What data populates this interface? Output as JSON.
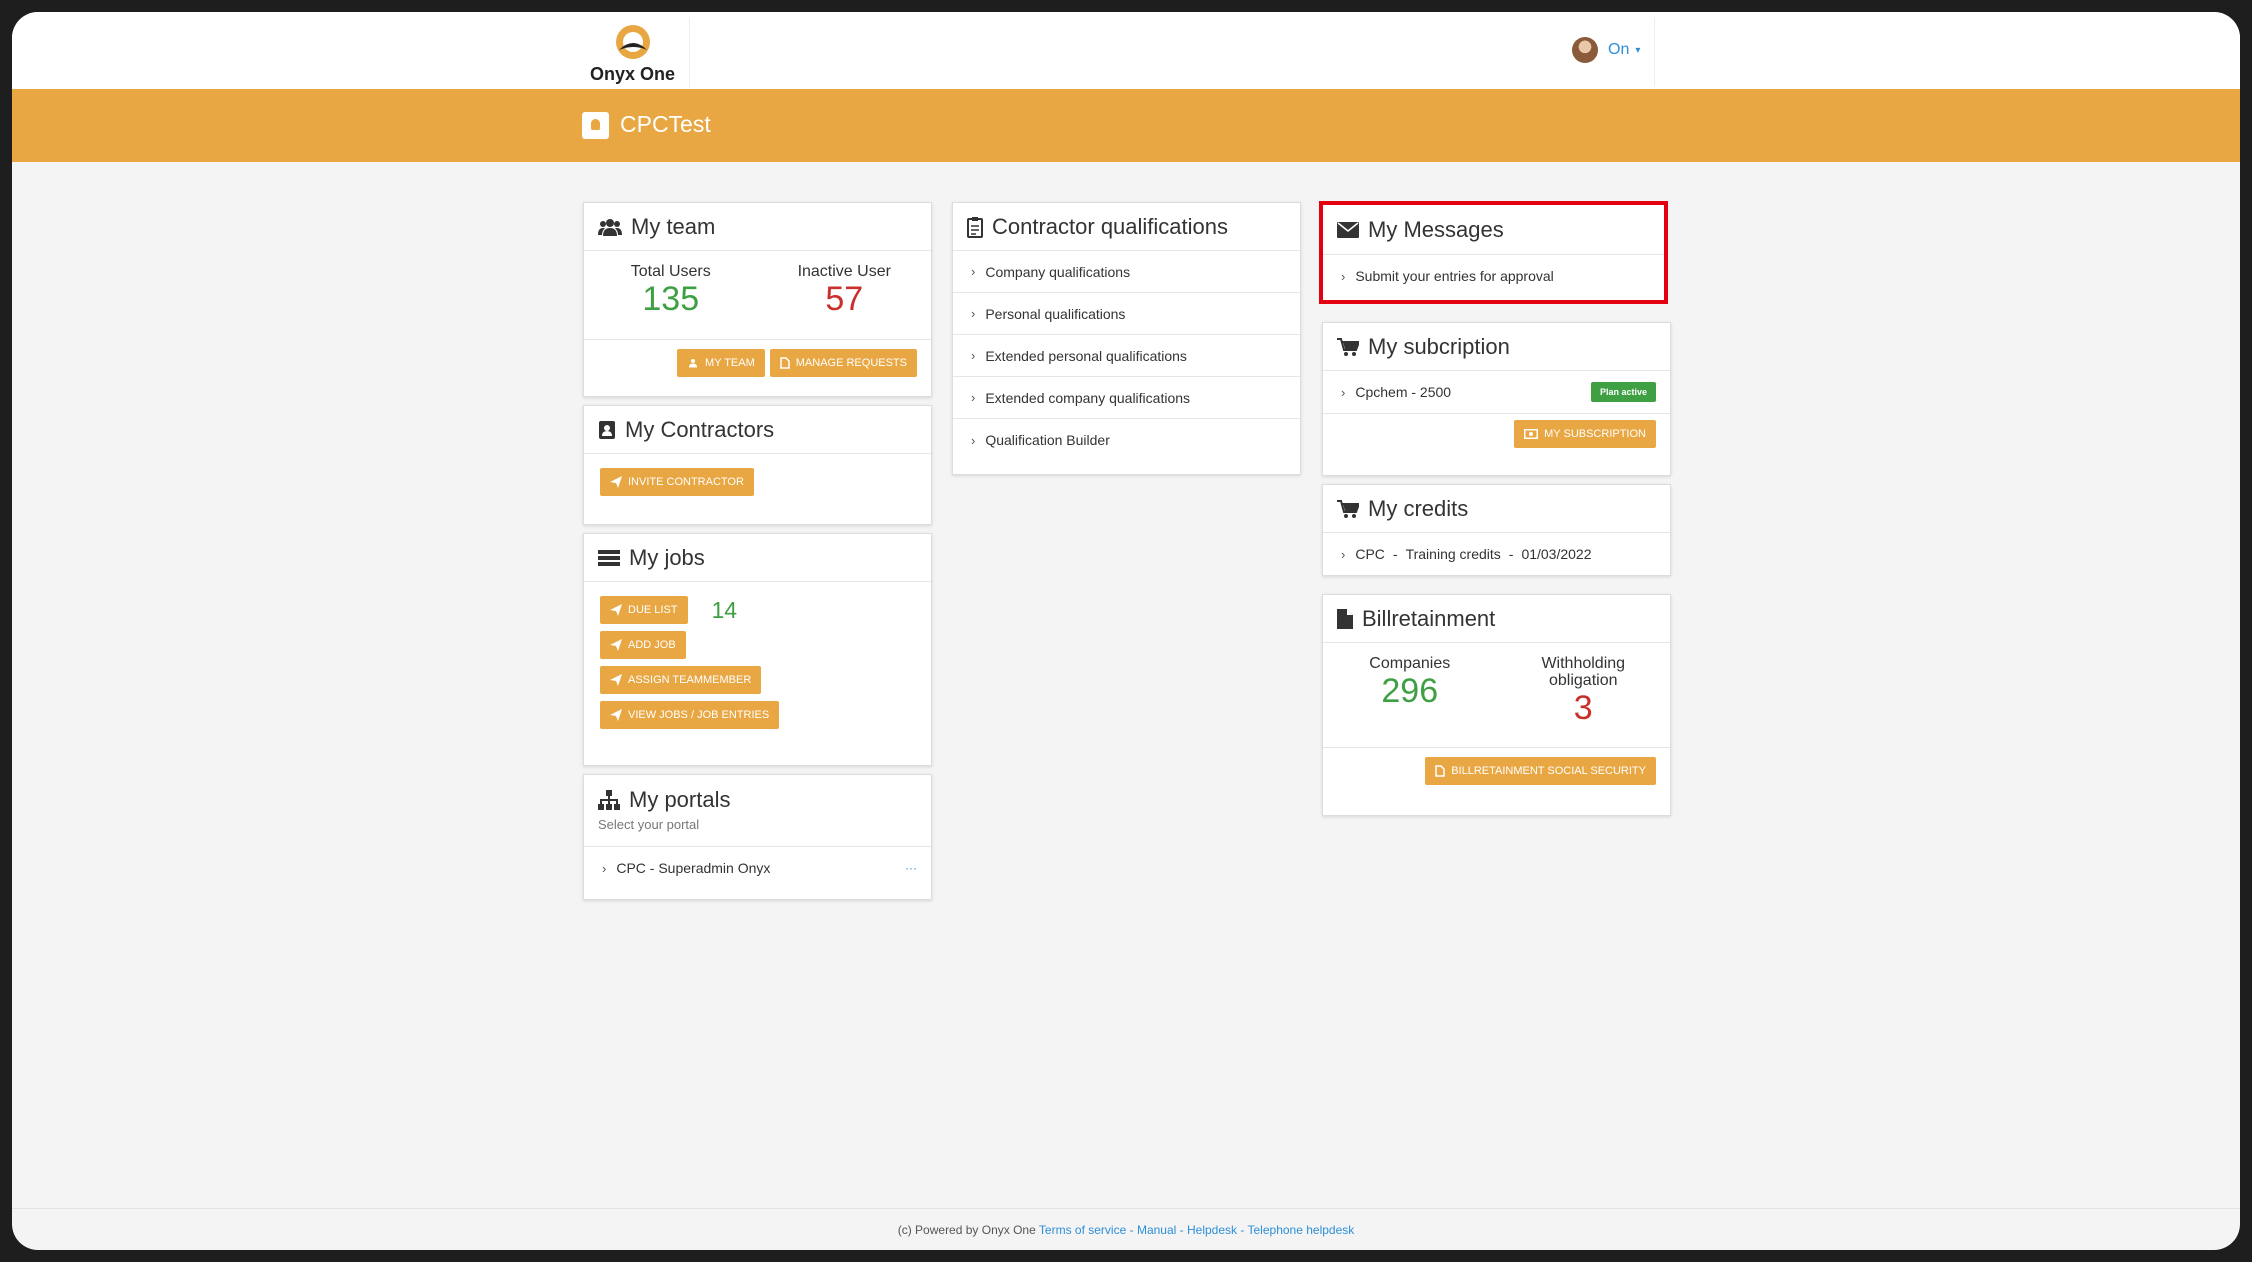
{
  "header": {
    "logo_text": "Onyx One",
    "user_name": "On",
    "caret": "▾"
  },
  "banner": {
    "title": "CPCTest"
  },
  "my_team": {
    "title": "My team",
    "total_users_label": "Total Users",
    "total_users_value": "135",
    "inactive_user_label": "Inactive User",
    "inactive_user_value": "57",
    "my_team_button": "MY TEAM",
    "manage_requests_button": "MANAGE REQUESTS"
  },
  "my_contractors": {
    "title": "My Contractors",
    "invite_button": "INVITE CONTRACTOR"
  },
  "my_jobs": {
    "title": "My jobs",
    "due_list_button": "DUE LIST",
    "due_count": "14",
    "add_job_button": "ADD JOB",
    "assign_button": "ASSIGN TEAMMEMBER",
    "view_jobs_button": "VIEW JOBS / JOB ENTRIES"
  },
  "my_portals": {
    "title": "My portals",
    "subtitle": "Select your portal",
    "item": "CPC - Superadmin Onyx",
    "more": "···"
  },
  "qualifications": {
    "title": "Contractor qualifications",
    "items": [
      "Company qualifications",
      "Personal qualifications",
      "Extended personal qualifications",
      "Extended company qualifications",
      "Qualification Builder"
    ]
  },
  "messages": {
    "title": "My Messages",
    "item": "Submit your entries for approval"
  },
  "subscription": {
    "title": "My subcription",
    "item": "Cpchem - 2500",
    "badge": "Plan active",
    "button": "MY SUBSCRIPTION"
  },
  "credits": {
    "title": "My credits",
    "item_company": "CPC",
    "item_type": "Training credits",
    "item_date": "01/03/2022",
    "separator": "-"
  },
  "billretainment": {
    "title": "Billretainment",
    "companies_label": "Companies",
    "companies_value": "296",
    "withholding_label_1": "Withholding",
    "withholding_label_2": "obligation",
    "withholding_value": "3",
    "button": "BILLRETAINMENT SOCIAL SECURITY"
  },
  "footer": {
    "prefix": "(c) Powered by Onyx One",
    "terms": "Terms of service",
    "manual": "Manual",
    "helpdesk": "Helpdesk",
    "telephone": "Telephone helpdesk",
    "sep": "-"
  },
  "colors": {
    "accent": "#e8a742",
    "green": "#3ea043",
    "red": "#c9302c",
    "link": "#2d8fd8",
    "highlight": "#e3000f"
  },
  "icons": {
    "team": "users-icon",
    "contractors": "id-badge-icon",
    "jobs": "list-icon",
    "portals": "sitemap-icon",
    "qualifications": "clipboard-icon",
    "messages": "envelope-icon",
    "subscription": "cart-icon",
    "credits": "cart-icon",
    "billretainment": "file-icon",
    "send": "paper-plane-icon"
  }
}
